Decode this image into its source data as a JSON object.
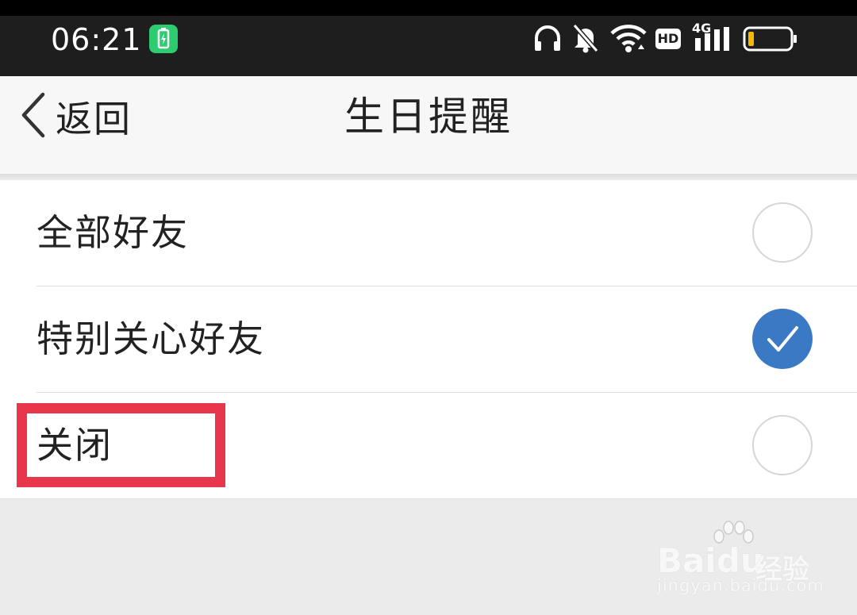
{
  "status_bar": {
    "time": "06:21",
    "icons": [
      "charging-badge-icon",
      "headphones-icon",
      "notifications-muted-icon",
      "wifi-icon",
      "hd-icon",
      "cellular-signal-icon",
      "battery-low-icon"
    ],
    "hd_label": "HD",
    "network_label": "4G",
    "colors": {
      "background": "#1e1e1e",
      "charge_badge": "#2ecc71",
      "battery_level": "#f5b700"
    }
  },
  "nav": {
    "back_label": "返回",
    "title": "生日提醒"
  },
  "options": [
    {
      "label": "全部好友",
      "selected": false
    },
    {
      "label": "特别关心好友",
      "selected": true
    },
    {
      "label": "关闭",
      "selected": false
    }
  ],
  "annotation": {
    "highlight_target": "关闭",
    "color": "#e8374d"
  },
  "watermark": {
    "brand": "Baidu",
    "sub": "经验",
    "url": "jingyan.baidu.com"
  },
  "colors": {
    "accent": "#3a79c4",
    "nav_background": "#f7f7f7",
    "page_background": "#ebebeb"
  }
}
